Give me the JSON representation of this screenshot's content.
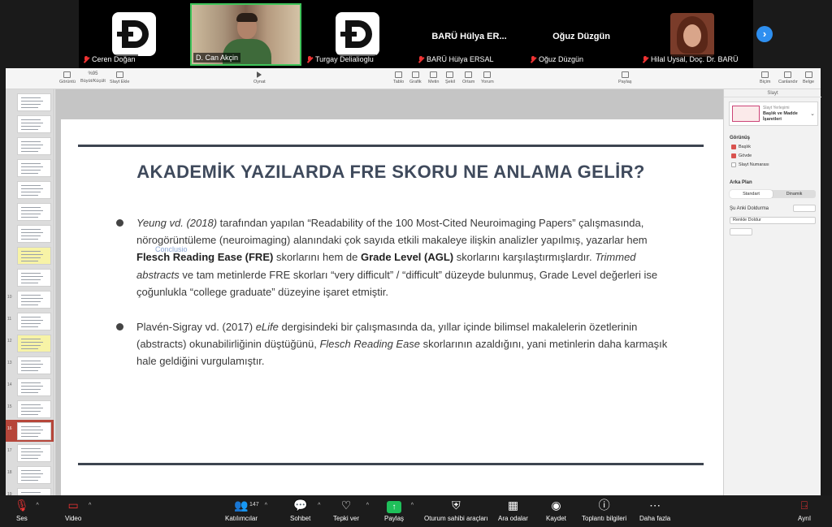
{
  "participants": [
    {
      "name": "Ceren Doğan",
      "kind": "logo",
      "muted": true
    },
    {
      "name": "D. Can Akçin",
      "kind": "video",
      "muted": false
    },
    {
      "name": "Turgay Delialioglu",
      "kind": "logo",
      "muted": true
    },
    {
      "name": "BARÜ Hülya ERSAL",
      "display": "BARÜ Hülya ER...",
      "kind": "text",
      "muted": true
    },
    {
      "name": "Oğuz Düzgün",
      "display": "Oğuz Düzgün",
      "kind": "text",
      "muted": true
    },
    {
      "name": "Hilal Uysal, Doç. Dr. BARÜ",
      "kind": "avatar",
      "muted": true
    }
  ],
  "toolbar": {
    "view": "Görüntü",
    "zoom": "%95",
    "zoom_label": "Büyüt/Küçült",
    "add_slide": "Slayt Ekle",
    "play": "Oynat",
    "table": "Tablo",
    "chart": "Grafik",
    "text": "Metin",
    "shape": "Şekil",
    "media": "Ortam",
    "comment": "Yorum",
    "share": "Paylaş",
    "format": "Biçim",
    "animate": "Canlandır",
    "document": "Belge"
  },
  "slides": [
    {
      "n": "",
      "kind": "text"
    },
    {
      "n": "",
      "kind": "text"
    },
    {
      "n": "",
      "kind": "text"
    },
    {
      "n": "",
      "kind": "text"
    },
    {
      "n": "",
      "kind": "text"
    },
    {
      "n": "",
      "kind": "text"
    },
    {
      "n": "",
      "kind": "text"
    },
    {
      "n": "",
      "kind": "yellow"
    },
    {
      "n": "",
      "kind": "text"
    },
    {
      "n": "10",
      "kind": "text"
    },
    {
      "n": "11",
      "kind": "text"
    },
    {
      "n": "12",
      "kind": "yellow"
    },
    {
      "n": "13",
      "kind": "text"
    },
    {
      "n": "14",
      "kind": "text"
    },
    {
      "n": "15",
      "kind": "text"
    },
    {
      "n": "16",
      "kind": "selected"
    },
    {
      "n": "17",
      "kind": "text"
    },
    {
      "n": "18",
      "kind": "text"
    },
    {
      "n": "19",
      "kind": "text"
    },
    {
      "n": "20",
      "kind": "text"
    }
  ],
  "slide": {
    "title": "AKADEMİK YAZILARDA FRE SKORU NE ANLAMA GELİR?",
    "ghost_text": "Conclusio",
    "b1": {
      "s1": "Yeung vd. (2018)",
      "s2": " tarafından yapılan “Readability of the 100 Most-Cited Neuroimaging Papers” çalışmasında, nörogörüntüleme (neuroimaging) alanındaki çok sayıda etkili makaleye ilişkin analizler yapılmış, yazarlar hem ",
      "s3": "Flesch Reading Ease (FRE)",
      "s4": " skorlarını hem de ",
      "s5": "Grade Level (AGL)",
      "s6": " skorlarını karşılaştırmışlardır. ",
      "s7": "Trimmed abstracts",
      "s8": " ve tam metinlerde FRE skorları “very difficult” / “difficult” düzeyde bulunmuş, Grade Level değerleri ise çoğunlukla “college graduate” düzeyine işaret etmiştir."
    },
    "b2": {
      "s1": "Plavén-Sigray vd. (2017) ",
      "s2": "eLife",
      "s3": " dergisindeki bir çalışmasında da, yıllar içinde bilimsel makalelerin özetlerinin (abstracts) okunabilirliğinin düştüğünü, ",
      "s4": "Flesch Reading Ease",
      "s5": " skorlarının azaldığını, yani metinlerin daha karmaşık hale geldiğini vurgulamıştır."
    }
  },
  "inspector": {
    "header": "Slayt",
    "layout_label": "Slayt Yerleşimi",
    "layout_name": "Başlık ve Madde İşaretleri",
    "appearance": "Görünüş",
    "chk_title": "Başlık",
    "chk_body": "Gövde",
    "chk_number": "Slayt Numarası",
    "background": "Arka Plan",
    "seg_standard": "Standart",
    "seg_dynamic": "Dinamik",
    "current_fill": "Şu Anki Doldurma",
    "fill_type": "Renkle Doldur"
  },
  "bottombar": {
    "audio": "Ses",
    "video": "Video",
    "participants": "Katılımcılar",
    "participant_count": "147",
    "chat": "Sohbet",
    "reactions": "Tepki ver",
    "share": "Paylaş",
    "host_tools": "Oturum sahibi araçları",
    "rooms": "Ara odalar",
    "record": "Kaydet",
    "info": "Toplantı bilgileri",
    "more": "Daha fazla",
    "leave": "Ayrıl"
  }
}
